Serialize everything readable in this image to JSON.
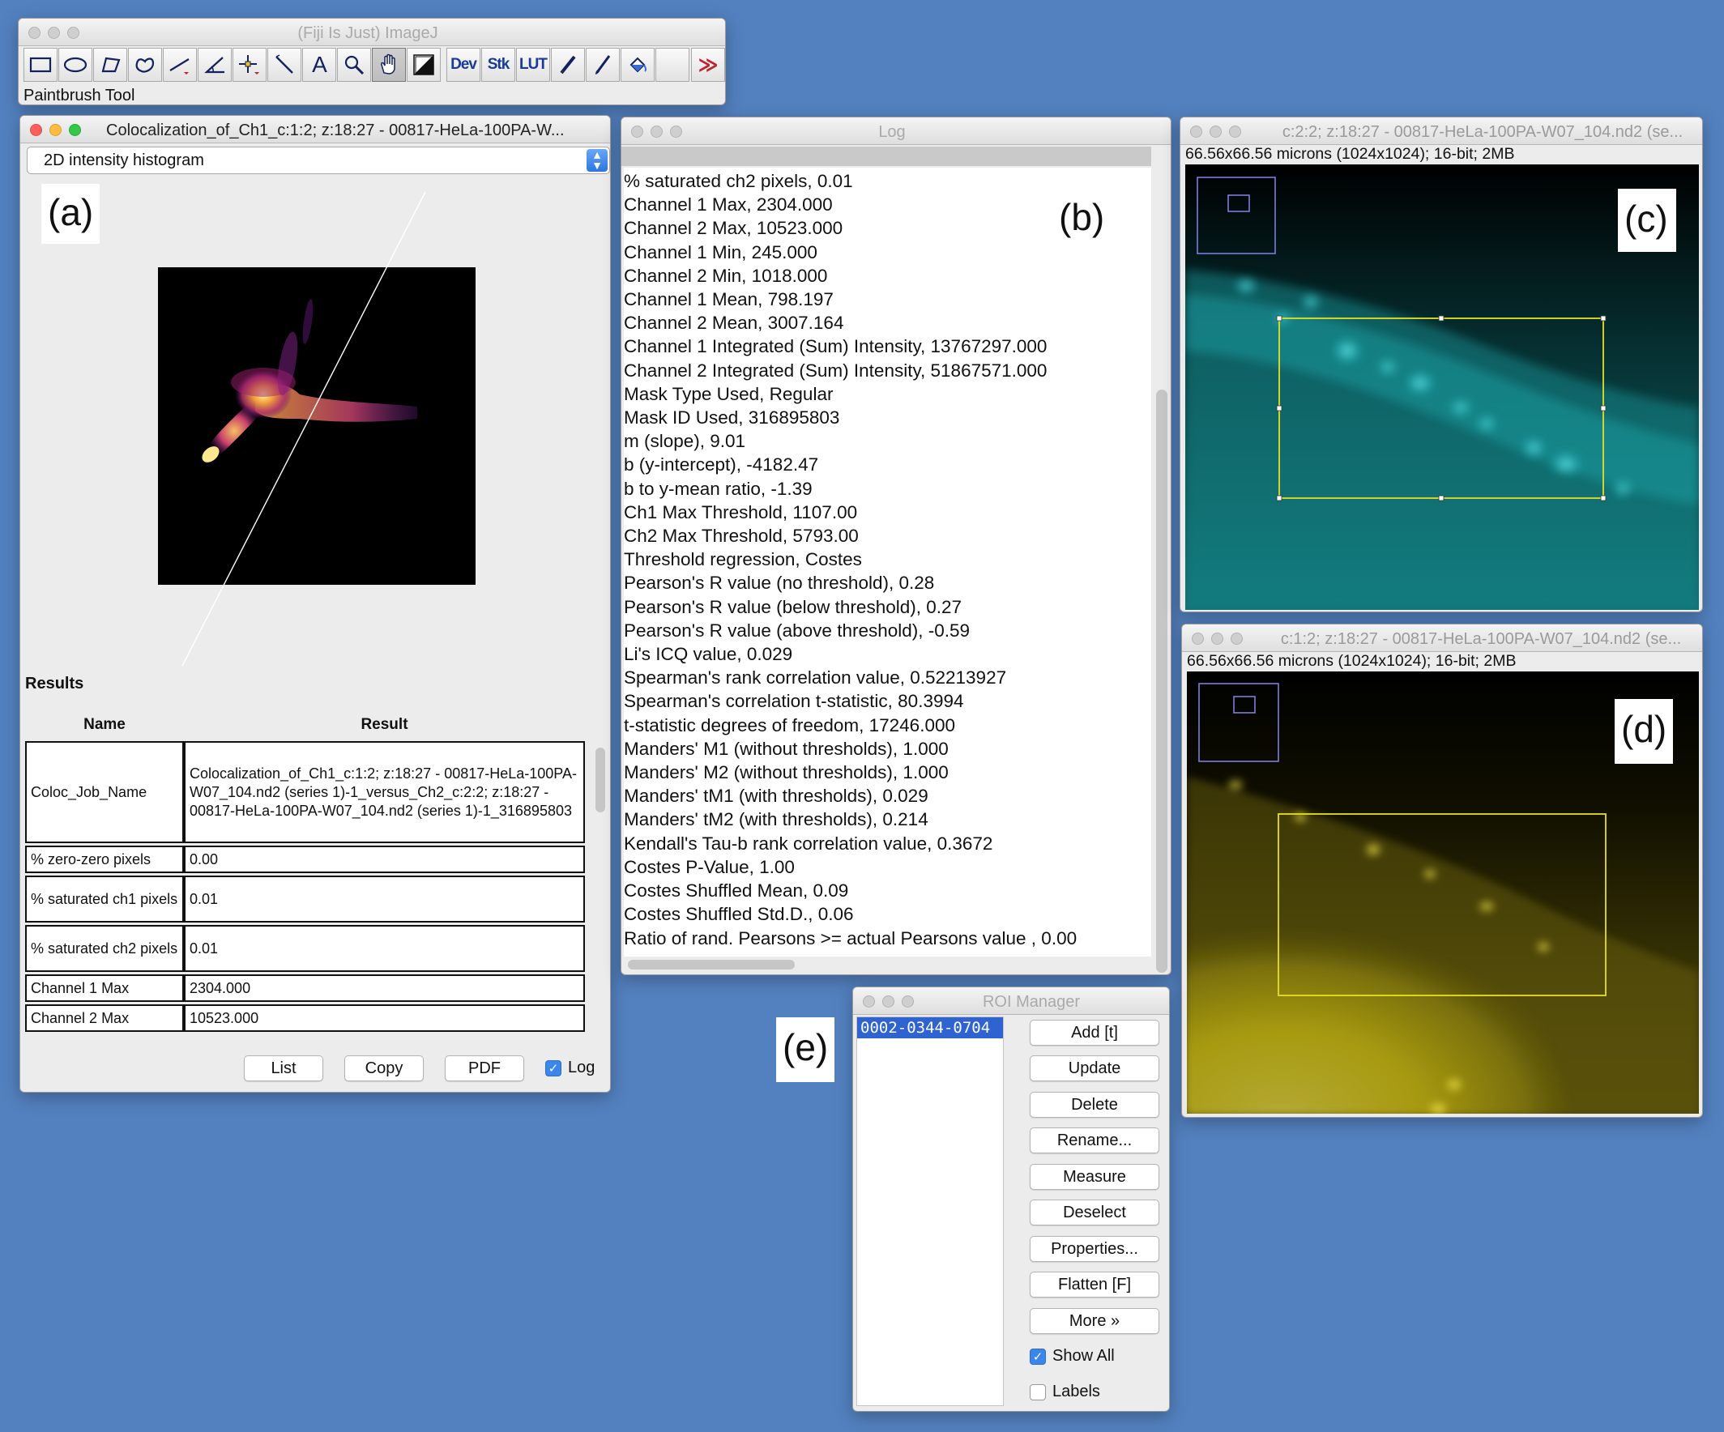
{
  "imagej": {
    "title": "(Fiji Is Just) ImageJ",
    "status": "Paintbrush Tool",
    "tools": [
      "rectangle-tool",
      "oval-tool",
      "polygon-tool",
      "freehand-tool",
      "line-tool",
      "angle-tool",
      "point-tool",
      "wand-tool",
      "text-tool",
      "magnifier-tool",
      "hand-tool",
      "color-picker-tool",
      "Dev",
      "Stk",
      "LUT",
      "pencil-tool",
      "paintbrush-tool",
      "flood-fill-tool",
      "empty-slot",
      "More tools"
    ],
    "dev": "Dev",
    "stk": "Stk",
    "lut": "LUT",
    "text_tool": "A",
    "more": "≫"
  },
  "coloc": {
    "title": "Colocalization_of_Ch1_c:1:2; z:18:27 - 00817-HeLa-100PA-W...",
    "dropdown": "2D intensity histogram",
    "label": "(a)",
    "results_title": "Results",
    "col_name": "Name",
    "col_result": "Result",
    "rows": [
      {
        "name": "Coloc_Job_Name",
        "result": "Colocalization_of_Ch1_c:1:2; z:18:27 - 00817-HeLa-100PA-W07_104.nd2 (series 1)-1_versus_Ch2_c:2:2; z:18:27 - 00817-HeLa-100PA-W07_104.nd2 (series 1)-1_316895803"
      },
      {
        "name": "% zero-zero pixels",
        "result": "0.00"
      },
      {
        "name": "% saturated ch1 pixels",
        "result": "0.01"
      },
      {
        "name": "% saturated ch2 pixels",
        "result": "0.01"
      },
      {
        "name": "Channel 1 Max",
        "result": "2304.000"
      },
      {
        "name": "Channel 2 Max",
        "result": "10523.000"
      }
    ],
    "btn_list": "List",
    "btn_copy": "Copy",
    "btn_pdf": "PDF",
    "log_label": "Log",
    "log_checked": true
  },
  "log": {
    "title": "Log",
    "label": "(b)",
    "lines": [
      "% saturated ch2 pixels, 0.01",
      "Channel 1 Max, 2304.000",
      "Channel 2 Max, 10523.000",
      "Channel 1 Min, 245.000",
      "Channel 2 Min, 1018.000",
      "Channel 1 Mean, 798.197",
      "Channel 2 Mean, 3007.164",
      "Channel 1 Integrated (Sum) Intensity, 13767297.000",
      "Channel 2 Integrated (Sum) Intensity, 51867571.000",
      "Mask Type Used, Regular",
      "Mask ID Used, 316895803",
      "m (slope), 9.01",
      "b (y-intercept), -4182.47",
      "b to y-mean ratio, -1.39",
      "Ch1 Max Threshold, 1107.00",
      "Ch2 Max Threshold, 5793.00",
      "Threshold regression, Costes",
      "Pearson's R value (no threshold), 0.28",
      "Pearson's R value (below threshold), 0.27",
      "Pearson's R value (above threshold), -0.59",
      "Li's ICQ value, 0.029",
      "Spearman's rank correlation value, 0.52213927",
      "Spearman's correlation t-statistic, 80.3994",
      "t-statistic degrees of freedom, 17246.000",
      "Manders' M1 (without thresholds), 1.000",
      "Manders' M2 (without thresholds), 1.000",
      "Manders' tM1 (with thresholds), 0.029",
      "Manders' tM2 (with thresholds), 0.214",
      "Kendall's Tau-b rank correlation value, 0.3672",
      "Costes P-Value, 1.00",
      "Costes Shuffled Mean, 0.09",
      "Costes Shuffled Std.D., 0.06",
      "Ratio of rand. Pearsons >= actual Pearsons value , 0.00"
    ]
  },
  "img_c": {
    "title": "c:2:2; z:18:27 - 00817-HeLa-100PA-W07_104.nd2 (se...",
    "info": "66.56x66.56 microns (1024x1024); 16-bit; 2MB",
    "label": "(c)",
    "color": "#1fb3b8"
  },
  "img_d": {
    "title": "c:1:2; z:18:27 - 00817-HeLa-100PA-W07_104.nd2 (se...",
    "info": "66.56x66.56 microns (1024x1024); 16-bit; 2MB",
    "label": "(d)",
    "color": "#e6d514"
  },
  "roi": {
    "title": "ROI Manager",
    "label": "(e)",
    "items": [
      "0002-0344-0704"
    ],
    "buttons": [
      "Add [t]",
      "Update",
      "Delete",
      "Rename...",
      "Measure",
      "Deselect",
      "Properties...",
      "Flatten [F]",
      "More »"
    ],
    "show_all": "Show All",
    "show_all_checked": true,
    "labels": "Labels",
    "labels_checked": false
  }
}
